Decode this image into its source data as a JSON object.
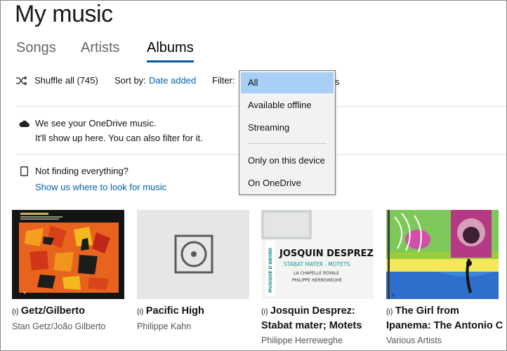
{
  "page": {
    "title": "My music"
  },
  "tabs": [
    {
      "label": "Songs",
      "active": false
    },
    {
      "label": "Artists",
      "active": false
    },
    {
      "label": "Albums",
      "active": true
    }
  ],
  "toolbar": {
    "shuffle_label": "Shuffle all (745)",
    "sort_label": "Sort by:",
    "sort_value": "Date added",
    "filter_label": "Filter:",
    "behind_dropdown_text": "s"
  },
  "filter_dropdown": {
    "items": [
      "All",
      "Available offline",
      "Streaming",
      "Only on this device",
      "On OneDrive"
    ],
    "selected": "All"
  },
  "notices": {
    "onedrive": {
      "line1": "We see your OneDrive music.",
      "line2": "It'll show up here. You can also filter for it."
    },
    "missing": {
      "line1": "Not finding everything?",
      "link": "Show us where to look for music"
    }
  },
  "albums": [
    {
      "title": "Getz/Gilberto",
      "artist": "Stan Getz/João Gilberto",
      "streaming_icon": "(ı)"
    },
    {
      "title": "Pacific High",
      "artist": "Philippe Kahn",
      "streaming_icon": "(ı)"
    },
    {
      "title_line1": "Josquin Desprez:",
      "title_line2": "Stabat mater; Motets",
      "artist": "Philippe Herreweghe",
      "streaming_icon": "(ı)",
      "cover_text": {
        "side": "MUSIQUE D'ABORD",
        "line1": "JOSQUIN DESPREZ",
        "line2": "STABAT MATER . MOTETS",
        "line3": "LA CHAPELLE ROYALE",
        "line4": "PHILIPPE HERREWEGHE"
      }
    },
    {
      "title_line1": "The Girl from",
      "title_line2": "Ipanema: The Antonio C",
      "artist": "Various Artists",
      "streaming_icon": "(ı)"
    }
  ],
  "colors": {
    "accent": "#0063b1",
    "tab_underline": "#005a9e",
    "selected_item": "#a8cff5"
  }
}
